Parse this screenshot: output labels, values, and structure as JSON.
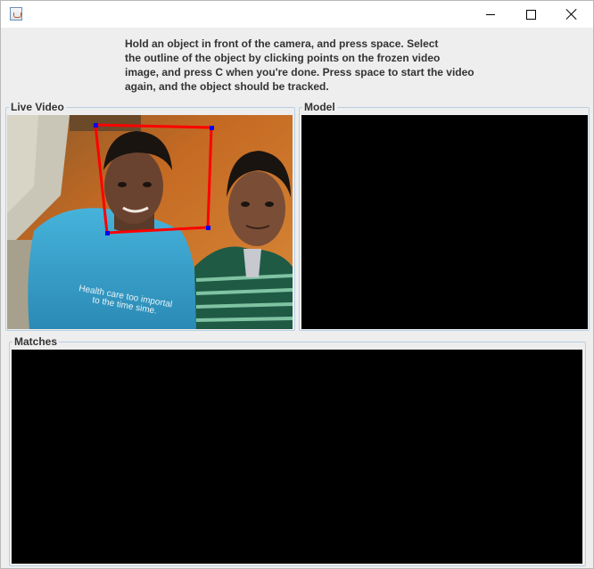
{
  "window": {
    "icon": "java-cup-icon",
    "buttons": [
      "minimize-icon",
      "maximize-icon",
      "close-icon"
    ]
  },
  "instructions": {
    "line1": "Hold an object in front of the camera, and press space. Select",
    "line2": "the outline of the object by clicking points on the frozen video",
    "line3": "image, and press C when you're done. Press space to start the video",
    "line4": "again, and the object should be tracked."
  },
  "panels": {
    "live_video": "Live Video",
    "model": "Model",
    "matches": "Matches"
  },
  "live_frame": {
    "shirt_text_line1": "Health care too importal",
    "shirt_text_line2": "to the time sime."
  },
  "colors": {
    "selection_outline": "#ff0000",
    "selection_points": "#0000ff",
    "panel_border": "#b8cfe5",
    "view_background": "#000000"
  }
}
